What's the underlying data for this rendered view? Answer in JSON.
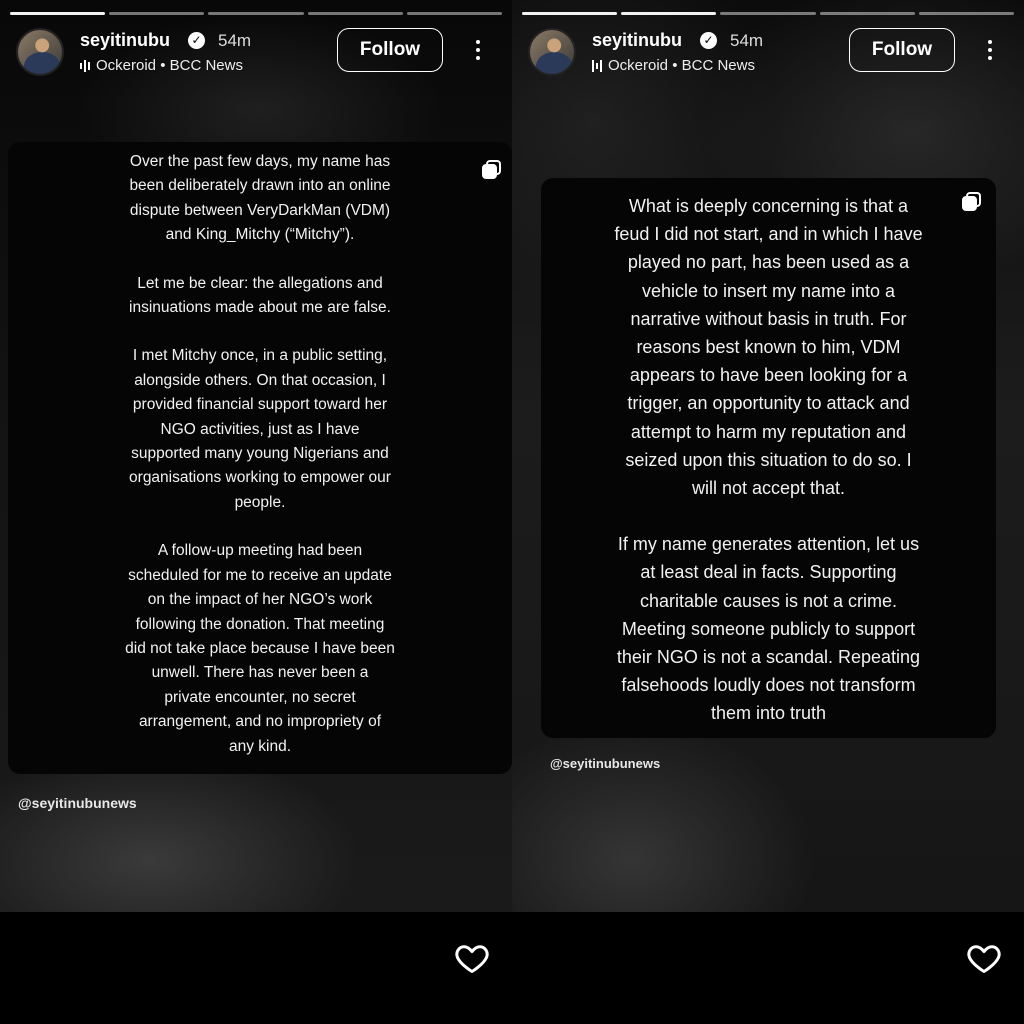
{
  "stories": [
    {
      "username": "seyitinubu",
      "time": "54m",
      "music": "Ockeroid • BCC News",
      "follow_label": "Follow",
      "paragraphs": [
        "Over the past few days, my name has\nbeen deliberately drawn into an online\ndispute between VeryDarkMan (VDM)\nand King_Mitchy (“Mitchy”).",
        "Let me be clear: the allegations and\ninsinuations made about me are false.",
        "I met Mitchy once, in a public setting,\nalongside others. On that occasion, I\nprovided financial support toward her\nNGO activities, just as I have\nsupported many young Nigerians and\norganisations working to empower our\npeople.",
        "A follow-up meeting had been\nscheduled for me to receive an update\non the impact of her NGO’s work\nfollowing the donation. That meeting\ndid not take place because I have been\nunwell. There has never been a\nprivate encounter, no secret\narrangement, and no impropriety of\nany kind."
      ],
      "mention": "@seyitinubunews"
    },
    {
      "username": "seyitinubu",
      "time": "54m",
      "music": "Ockeroid • BCC News",
      "follow_label": "Follow",
      "paragraphs": [
        "What is deeply concerning is that a\nfeud I did not start, and in which I have\nplayed no part, has been used as a\nvehicle to insert my name into a\nnarrative without basis in truth. For\nreasons best known to him, VDM\nappears to have been looking for a\ntrigger, an opportunity to attack and\nattempt to harm my reputation and\nseized upon this situation to do so. I\nwill not accept that.",
        "If my name generates attention, let us\nat least deal in facts. Supporting\ncharitable causes is not a crime.\nMeeting someone publicly to support\ntheir NGO is not a scandal. Repeating\nfalsehoods loudly does not transform\nthem into truth"
      ],
      "mention": "@seyitinubunews"
    }
  ],
  "icons": {
    "verified": "verified-badge-icon",
    "music": "audio-bars-icon",
    "more": "more-vertical-icon",
    "copy": "copy-sticker-icon",
    "like": "heart-outline-icon"
  },
  "colors": {
    "background": "#000000",
    "card": "#050505",
    "text": "#f2f2f2"
  }
}
